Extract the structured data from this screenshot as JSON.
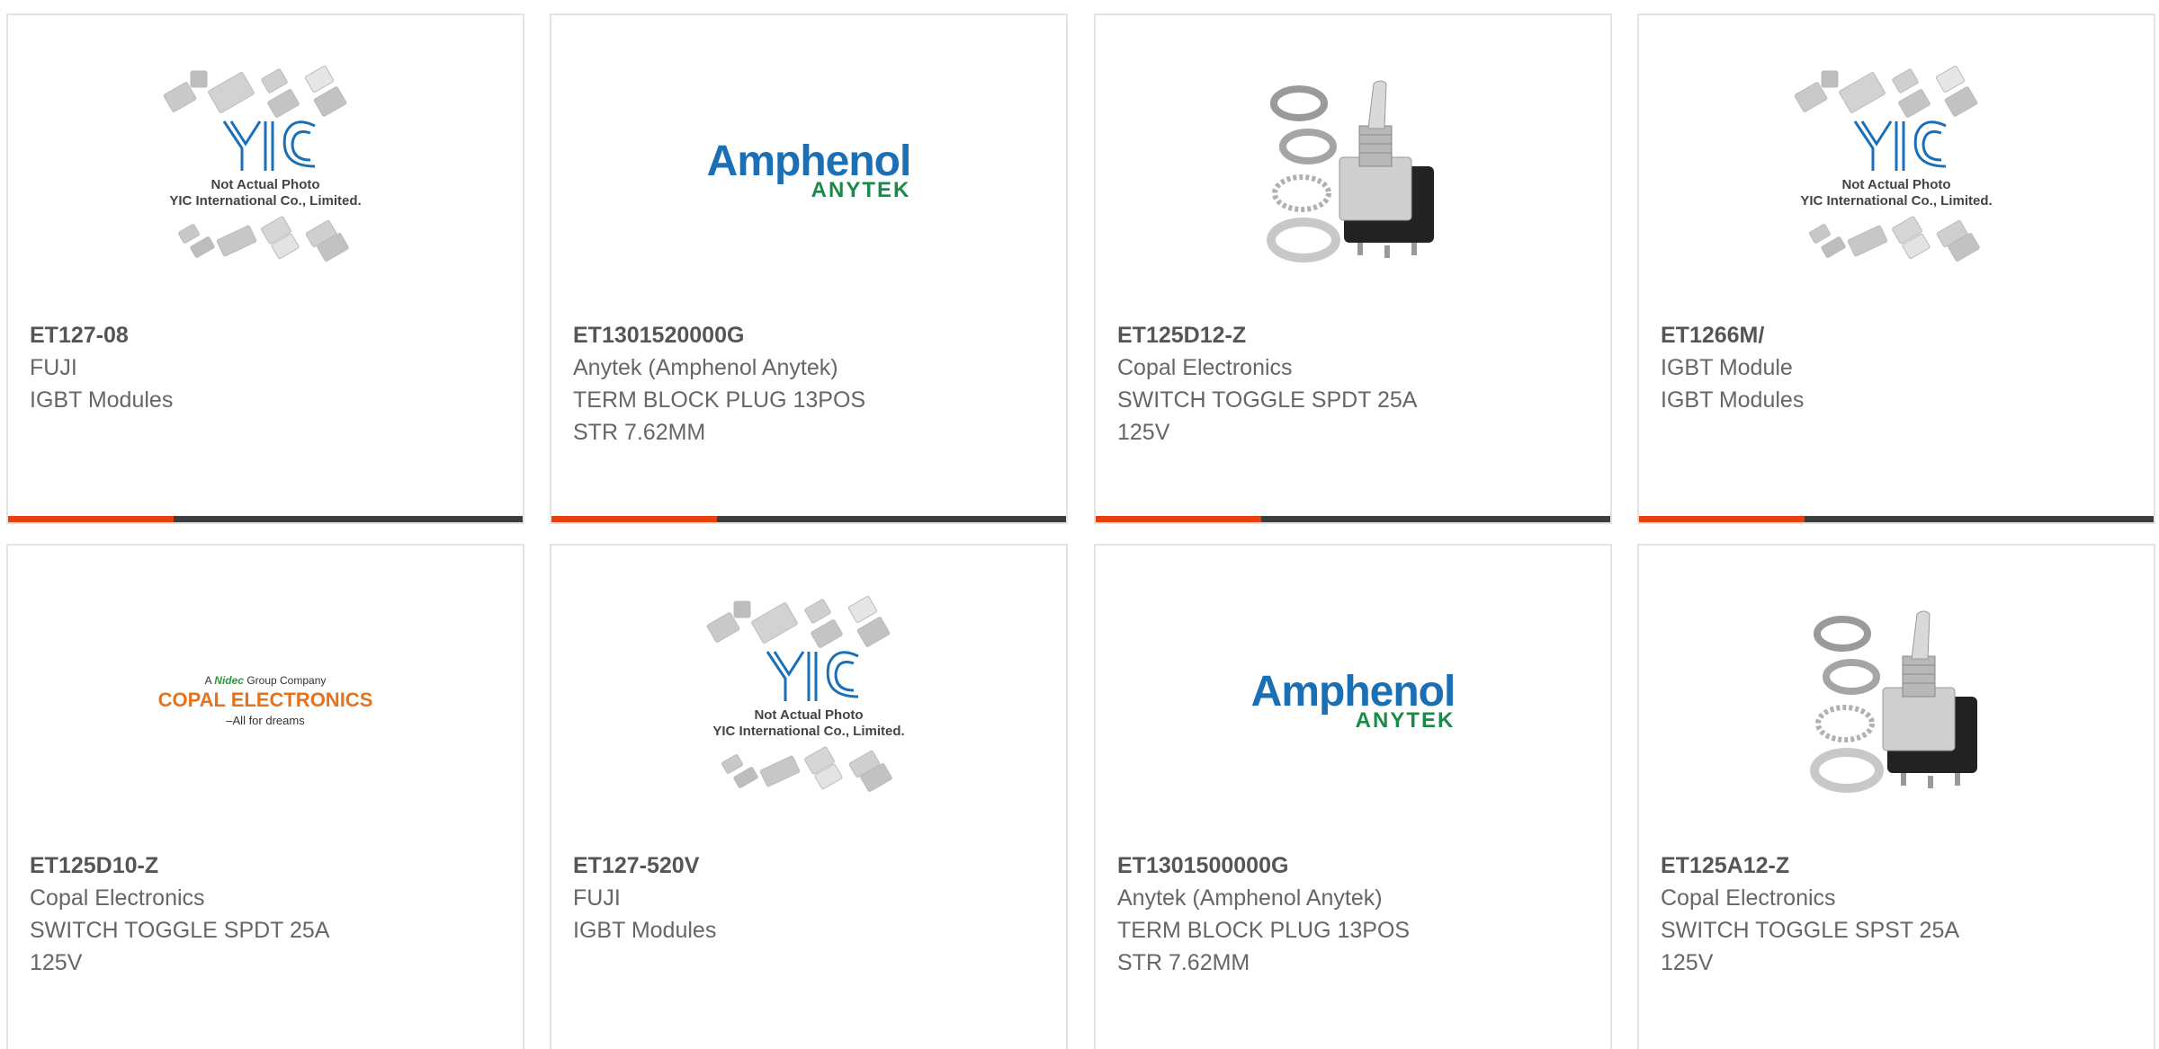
{
  "products": [
    {
      "part_number": "ET127-08",
      "manufacturer": "FUJI",
      "description": [
        "IGBT Modules"
      ],
      "image": "yic-placeholder",
      "image_text": [
        "Not Actual Photo",
        "YIC International Co., Limited."
      ],
      "has_bar": true
    },
    {
      "part_number": "ET1301520000G",
      "manufacturer": "Anytek (Amphenol Anytek)",
      "description": [
        "TERM BLOCK PLUG 13POS",
        "STR 7.62MM"
      ],
      "image": "amphenol-anytek-logo",
      "image_text": [
        "Amphenol",
        "ANYTEK"
      ],
      "has_bar": true
    },
    {
      "part_number": "ET125D12-Z",
      "manufacturer": "Copal Electronics",
      "description": [
        "SWITCH TOGGLE SPDT 25A",
        "125V"
      ],
      "image": "toggle-switch-photo",
      "image_text": [],
      "has_bar": true
    },
    {
      "part_number": "ET1266M/",
      "manufacturer": "IGBT Module",
      "description": [
        "IGBT Modules"
      ],
      "image": "yic-placeholder",
      "image_text": [
        "Not Actual Photo",
        "YIC International Co., Limited."
      ],
      "has_bar": true
    },
    {
      "part_number": "ET125D10-Z",
      "manufacturer": "Copal Electronics",
      "description": [
        "SWITCH TOGGLE SPDT 25A",
        "125V"
      ],
      "image": "copal-electronics-logo",
      "image_text": [
        "A",
        "Nidec",
        "Group Company",
        "COPAL ELECTRONICS",
        "–All for dreams"
      ],
      "has_bar": false
    },
    {
      "part_number": "ET127-520V",
      "manufacturer": "FUJI",
      "description": [
        "IGBT Modules"
      ],
      "image": "yic-placeholder",
      "image_text": [
        "Not Actual Photo",
        "YIC International Co., Limited."
      ],
      "has_bar": false
    },
    {
      "part_number": "ET1301500000G",
      "manufacturer": "Anytek (Amphenol Anytek)",
      "description": [
        "TERM BLOCK PLUG 13POS",
        "STR 7.62MM"
      ],
      "image": "amphenol-anytek-logo",
      "image_text": [
        "Amphenol",
        "ANYTEK"
      ],
      "has_bar": false
    },
    {
      "part_number": "ET125A12-Z",
      "manufacturer": "Copal Electronics",
      "description": [
        "SWITCH TOGGLE SPST 25A",
        "125V"
      ],
      "image": "toggle-switch-photo",
      "image_text": [],
      "has_bar": false
    }
  ],
  "colors": {
    "accent": "#e8400c",
    "bar": "#3d3d3d",
    "border": "#e3e3e3",
    "part_number_text": "#555555",
    "body_text": "#666666"
  }
}
